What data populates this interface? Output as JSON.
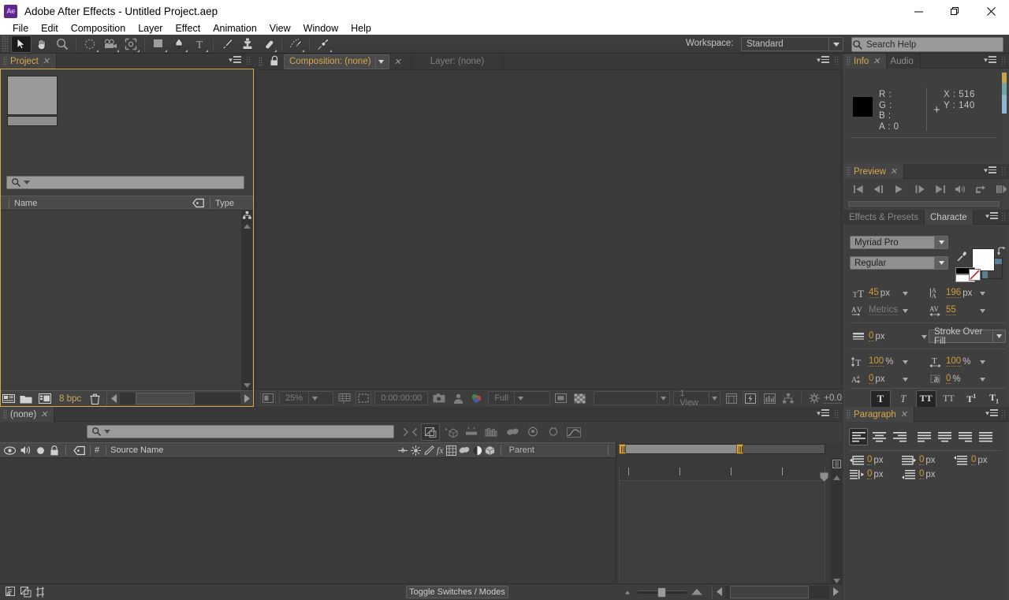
{
  "window": {
    "app_icon_label": "Ae",
    "title": "Adobe After Effects - Untitled Project.aep",
    "controls": {
      "minimize": "minimize-button",
      "maximize": "maximize-button",
      "close": "close-button"
    }
  },
  "menubar": {
    "items": [
      "File",
      "Edit",
      "Composition",
      "Layer",
      "Effect",
      "Animation",
      "View",
      "Window",
      "Help"
    ]
  },
  "toolbar": {
    "tools": [
      {
        "name": "selection-tool",
        "selected": true
      },
      {
        "name": "hand-tool",
        "selected": false
      },
      {
        "name": "zoom-tool",
        "selected": false
      },
      {
        "name": "rotation-tool",
        "selected": false
      },
      {
        "name": "camera-tool",
        "selected": false
      },
      {
        "name": "pan-behind-tool",
        "selected": false
      },
      {
        "name": "rectangle-tool",
        "selected": false
      },
      {
        "name": "pen-tool",
        "selected": false
      },
      {
        "name": "type-tool",
        "selected": false
      },
      {
        "name": "brush-tool",
        "selected": false
      },
      {
        "name": "clone-stamp-tool",
        "selected": false
      },
      {
        "name": "eraser-tool",
        "selected": false
      },
      {
        "name": "roto-brush-tool",
        "selected": false
      },
      {
        "name": "puppet-pin-tool",
        "selected": false
      }
    ],
    "workspace_label": "Workspace:",
    "workspace_value": "Standard",
    "search_placeholder": "Search Help"
  },
  "project_panel": {
    "tab_label": "Project",
    "search_value": "",
    "columns": [
      "Name",
      "Type"
    ],
    "color_depth": "8 bpc",
    "footer_buttons": [
      "new-composition",
      "new-folder",
      "project-settings",
      "delete"
    ]
  },
  "composition_panel": {
    "tabs": [
      {
        "label": "Composition: (none)",
        "active": true
      },
      {
        "label": "Layer: (none)",
        "active": false
      }
    ],
    "footer": {
      "magnification": "25%",
      "timecode": "0:00:00:00",
      "resolution": "Full",
      "view_layout": "1 View",
      "renderer_value": "",
      "exposure": "+0.0"
    }
  },
  "info_panel": {
    "tabs": [
      {
        "label": "Info",
        "active": true
      },
      {
        "label": "Audio",
        "active": false
      }
    ],
    "channels": {
      "r_label": "R :",
      "g_label": "G :",
      "b_label": "B :",
      "a_label": "A : 0"
    },
    "position": {
      "x": "X : 516",
      "y": "Y : 140"
    },
    "swatch_color": "#000000"
  },
  "preview_panel": {
    "tab_label": "Preview",
    "buttons": [
      "first-frame",
      "previous-frame",
      "play",
      "next-frame",
      "last-frame",
      "audio",
      "loop",
      "ram-preview"
    ]
  },
  "character_panel": {
    "tabs": [
      {
        "label": "Effects & Presets",
        "active": false
      },
      {
        "label": "Characte",
        "active": true
      }
    ],
    "font_family": "Myriad Pro",
    "font_style": "Regular",
    "font_size": "45",
    "font_size_unit": "px",
    "leading": "196",
    "leading_unit": "px",
    "kerning": "Metrics",
    "tracking": "55",
    "stroke_width": "0",
    "stroke_width_unit": "px",
    "stroke_order": "Stroke Over Fill",
    "vertical_scale": "100",
    "vertical_scale_unit": "%",
    "horizontal_scale": "100",
    "horizontal_scale_unit": "%",
    "baseline_shift": "0",
    "baseline_shift_unit": "px",
    "tsume": "0",
    "tsume_unit": "%",
    "style_buttons": [
      {
        "name": "faux-bold",
        "glyph": "T",
        "on": true
      },
      {
        "name": "faux-italic",
        "glyph": "T",
        "on": false
      },
      {
        "name": "all-caps",
        "glyph": "TT",
        "on": true
      },
      {
        "name": "small-caps",
        "glyph": "TT",
        "on": false
      },
      {
        "name": "superscript",
        "glyph": "T",
        "on": false
      },
      {
        "name": "subscript",
        "glyph": "T",
        "on": false
      }
    ],
    "fill_color": "#ffffff",
    "stroke_color": "#5a7f93"
  },
  "paragraph_panel": {
    "tab_label": "Paragraph",
    "alignments": [
      "align-left",
      "align-center",
      "align-right",
      "justify-last-left",
      "justify-last-center",
      "justify-last-right",
      "justify-all"
    ],
    "indents": [
      {
        "name": "indent-left",
        "value": "0",
        "unit": "px"
      },
      {
        "name": "indent-right",
        "value": "0",
        "unit": "px"
      },
      {
        "name": "space-before",
        "value": "0",
        "unit": "px"
      },
      {
        "name": "indent-first-line",
        "value": "0",
        "unit": "px"
      },
      {
        "name": "space-after",
        "value": "0",
        "unit": "px"
      }
    ]
  },
  "timeline_panel": {
    "tab_label": "(none)",
    "search_value": "",
    "columns": [
      "#",
      "Source Name",
      "Parent"
    ],
    "toggle_switches_label": "Toggle Switches / Modes",
    "switch_icons": [
      "shy",
      "frame-blending",
      "motion-blur",
      "graph-editor"
    ],
    "layer_switch_icons": [
      "anchor",
      "quality",
      "effects-fx",
      "frame-blend",
      "motion-blur",
      "adjustment",
      "3d-layer"
    ],
    "bottom_icons": [
      "composition-mini-flowchart",
      "draft-3d",
      "hide-shy-layers"
    ]
  }
}
